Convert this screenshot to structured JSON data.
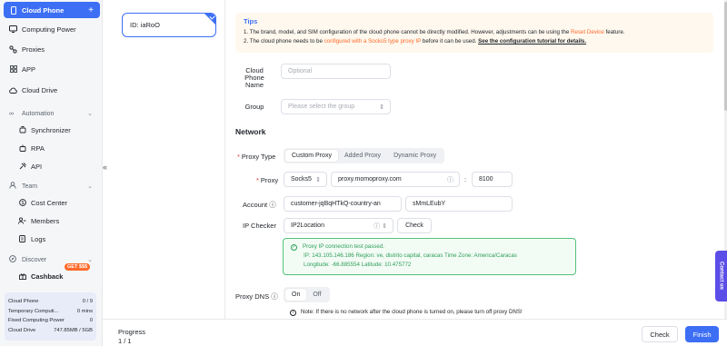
{
  "sidebar": {
    "items": [
      {
        "label": "Cloud Phone",
        "icon": "phone-icon"
      },
      {
        "label": "Computing Power",
        "icon": "monitor-icon"
      },
      {
        "label": "Proxies",
        "icon": "proxy-icon"
      },
      {
        "label": "APP",
        "icon": "grid-icon"
      },
      {
        "label": "Cloud Drive",
        "icon": "cloud-icon"
      }
    ],
    "automation": {
      "label": "Automation",
      "items": [
        "Synchronizer",
        "RPA",
        "API"
      ]
    },
    "team": {
      "label": "Team",
      "items": [
        "Cost Center",
        "Members",
        "Logs"
      ]
    },
    "discover": {
      "label": "Discover",
      "items": [
        "Cashback"
      ],
      "badge": "GET $$$"
    },
    "stats": [
      {
        "label": "Cloud Phone",
        "value": "0 / 9"
      },
      {
        "label": "Temporary Computi...",
        "value": "0 mins"
      },
      {
        "label": "Fixed Computing Power",
        "value": "0"
      },
      {
        "label": "Cloud Drive",
        "value": "747.85MB / 5GB"
      }
    ]
  },
  "device": {
    "id_label": "ID: iaRoO"
  },
  "tips": {
    "title": "Tips",
    "line1_a": "1. The brand, model, and SIM configuration of the cloud phone cannot be directly modified. However, adjustments can be using the ",
    "line1_b": "Reset Device",
    "line1_c": " feature.",
    "line2_a": "2. The cloud phone needs to be ",
    "line2_b": "configured with a Socks5 type proxy IP",
    "line2_c": " before it can be used. ",
    "line2_d": "See the configuration tutorial for details."
  },
  "form": {
    "name_label_1": "Cloud",
    "name_label_2": "Phone",
    "name_label_3": "Name",
    "name_placeholder": "Optional",
    "group_label": "Group",
    "group_placeholder": "Please select the group",
    "network_title": "Network",
    "proxy_type_label": "Proxy Type",
    "proxy_types": [
      "Custom Proxy",
      "Added Proxy",
      "Dynamic Proxy"
    ],
    "proxy_label": "Proxy",
    "proxy_protocol": "Socks5",
    "proxy_host": "proxy.momoproxy.com",
    "proxy_port": "8100",
    "colon": ":",
    "account_label": "Account",
    "account_user": "customer-jqBqHTkQ-country-an",
    "account_pass": "sMmLEubY",
    "checker_label": "IP Checker",
    "checker_value": "IP2Location",
    "check_button": "Check",
    "dns_label": "Proxy DNS",
    "dns_on": "On",
    "dns_off": "Off"
  },
  "result": {
    "title": "Proxy IP connection test passed.",
    "line1": "IP:  143.105.146.186  Region:  ve, distrito capital, caracas  Time Zone:  America/Caracas",
    "line2": "Longitude:  -66.885554  Latitude:  10.475772"
  },
  "note": "Note: If there is no network after the cloud phone is turned on, please turn off proxy DNS!",
  "footer": {
    "progress_label": "Progress",
    "progress_value": "1 / 1",
    "check": "Check",
    "finish": "Finish"
  },
  "contact": "Contact us",
  "colors": {
    "accent": "#3d6ff5",
    "orange": "#ff6a2a",
    "success": "#2ea05a"
  }
}
